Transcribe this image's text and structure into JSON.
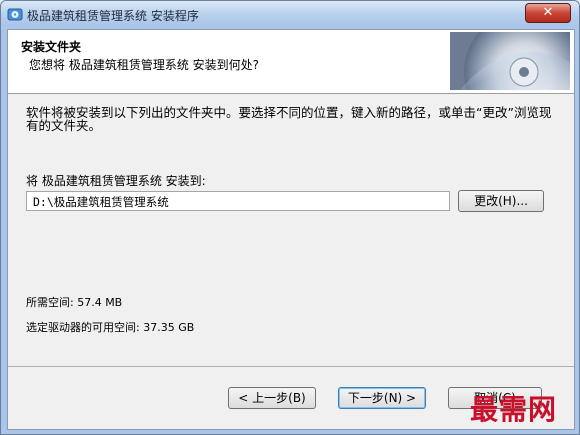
{
  "window": {
    "title": "极品建筑租赁管理系统 安装程序",
    "close_label": "✕"
  },
  "header": {
    "title": "安装文件夹",
    "subtitle": "您想将 极品建筑租赁管理系统 安装到何处?"
  },
  "body": {
    "description": "软件将被安装到以下列出的文件夹中。要选择不同的位置，键入新的路径，或单击“更改”浏览现有的文件夹。",
    "dest_label": "将 极品建筑租赁管理系统 安装到:",
    "path_value": "D:\\极品建筑租赁管理系统",
    "browse_label": "更改(H)...",
    "required_space": "所需空间: 57.4 MB",
    "available_space": "选定驱动器的可用空间: 37.35 GB"
  },
  "footer": {
    "back_label": "< 上一步(B)",
    "next_label": "下一步(N) >",
    "cancel_label": "取消(C)"
  },
  "watermark": "最需网",
  "colors": {
    "accent": "#3c7fb1",
    "watermark": "#c9102b",
    "title_bar": "#b9d1ee"
  }
}
